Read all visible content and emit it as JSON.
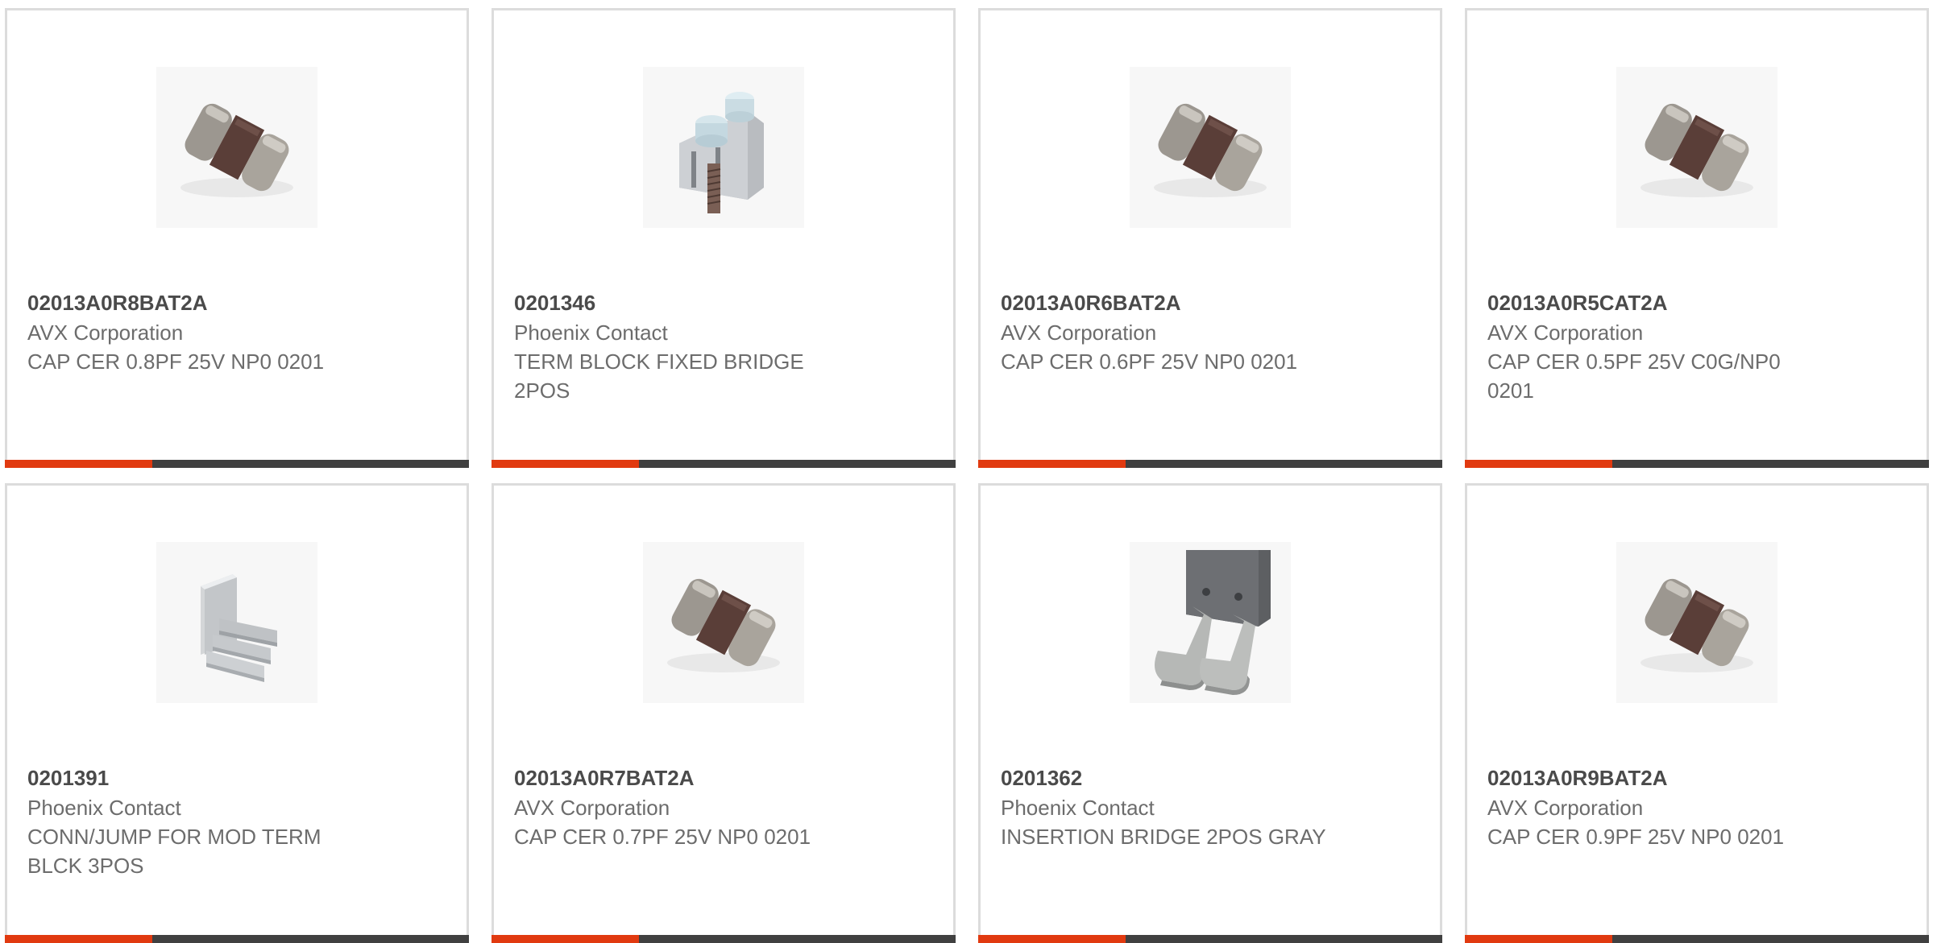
{
  "accent_color": "#e13a10",
  "bar_color": "#404040",
  "products": [
    {
      "part_number": "02013A0R8BAT2A",
      "manufacturer": "AVX Corporation",
      "description": "CAP CER 0.8PF 25V NP0 0201",
      "image": "ceramic-capacitor-chip-image"
    },
    {
      "part_number": "0201346",
      "manufacturer": "Phoenix Contact",
      "description": "TERM BLOCK FIXED BRIDGE 2POS",
      "image": "terminal-block-bridge-image"
    },
    {
      "part_number": "02013A0R6BAT2A",
      "manufacturer": "AVX Corporation",
      "description": "CAP CER 0.6PF 25V NP0 0201",
      "image": "ceramic-capacitor-chip-image"
    },
    {
      "part_number": "02013A0R5CAT2A",
      "manufacturer": "AVX Corporation",
      "description": "CAP CER 0.5PF 25V C0G/NP0 0201",
      "image": "ceramic-capacitor-chip-image"
    },
    {
      "part_number": "0201391",
      "manufacturer": "Phoenix Contact",
      "description": "CONN/JUMP FOR MOD TERM BLCK 3POS",
      "image": "jumper-3pos-image"
    },
    {
      "part_number": "02013A0R7BAT2A",
      "manufacturer": "AVX Corporation",
      "description": "CAP CER 0.7PF 25V NP0 0201",
      "image": "ceramic-capacitor-chip-image"
    },
    {
      "part_number": "0201362",
      "manufacturer": "Phoenix Contact",
      "description": "INSERTION BRIDGE 2POS GRAY",
      "image": "insertion-bridge-image"
    },
    {
      "part_number": "02013A0R9BAT2A",
      "manufacturer": "AVX Corporation",
      "description": "CAP CER 0.9PF 25V NP0 0201",
      "image": "ceramic-capacitor-chip-image"
    }
  ]
}
